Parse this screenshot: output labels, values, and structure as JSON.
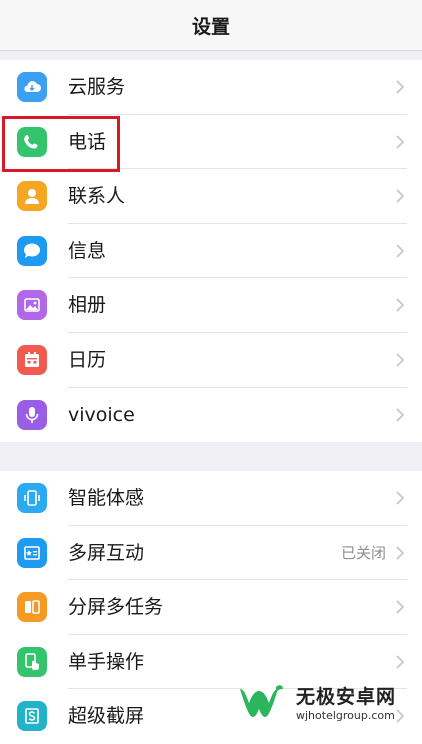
{
  "header": {
    "title": "设置"
  },
  "groups": [
    {
      "items": [
        {
          "label": "云服务",
          "icon": "cloud-icon",
          "color": "#3ba0f3"
        },
        {
          "label": "电话",
          "icon": "phone-icon",
          "color": "#34c46e"
        },
        {
          "label": "联系人",
          "icon": "contact-icon",
          "color": "#f5a623"
        },
        {
          "label": "信息",
          "icon": "message-icon",
          "color": "#1e9af0"
        },
        {
          "label": "相册",
          "icon": "album-icon",
          "color": "#b068e8"
        },
        {
          "label": "日历",
          "icon": "calendar-icon",
          "color": "#f05a4f"
        },
        {
          "label": "vivoice",
          "icon": "microphone-icon",
          "color": "#9a5ee6"
        }
      ]
    },
    {
      "items": [
        {
          "label": "智能体感",
          "icon": "motion-icon",
          "color": "#2ba9f2"
        },
        {
          "label": "多屏互动",
          "icon": "multiscreen-icon",
          "color": "#1e9af0",
          "value": "已关闭"
        },
        {
          "label": "分屏多任务",
          "icon": "split-screen-icon",
          "color": "#f59a23"
        },
        {
          "label": "单手操作",
          "icon": "one-hand-icon",
          "color": "#34c46e"
        },
        {
          "label": "超级截屏",
          "icon": "screenshot-icon",
          "color": "#22b3c9"
        }
      ]
    }
  ],
  "watermark": {
    "title": "无极安卓网",
    "url": "wjhotelgroup.com"
  }
}
